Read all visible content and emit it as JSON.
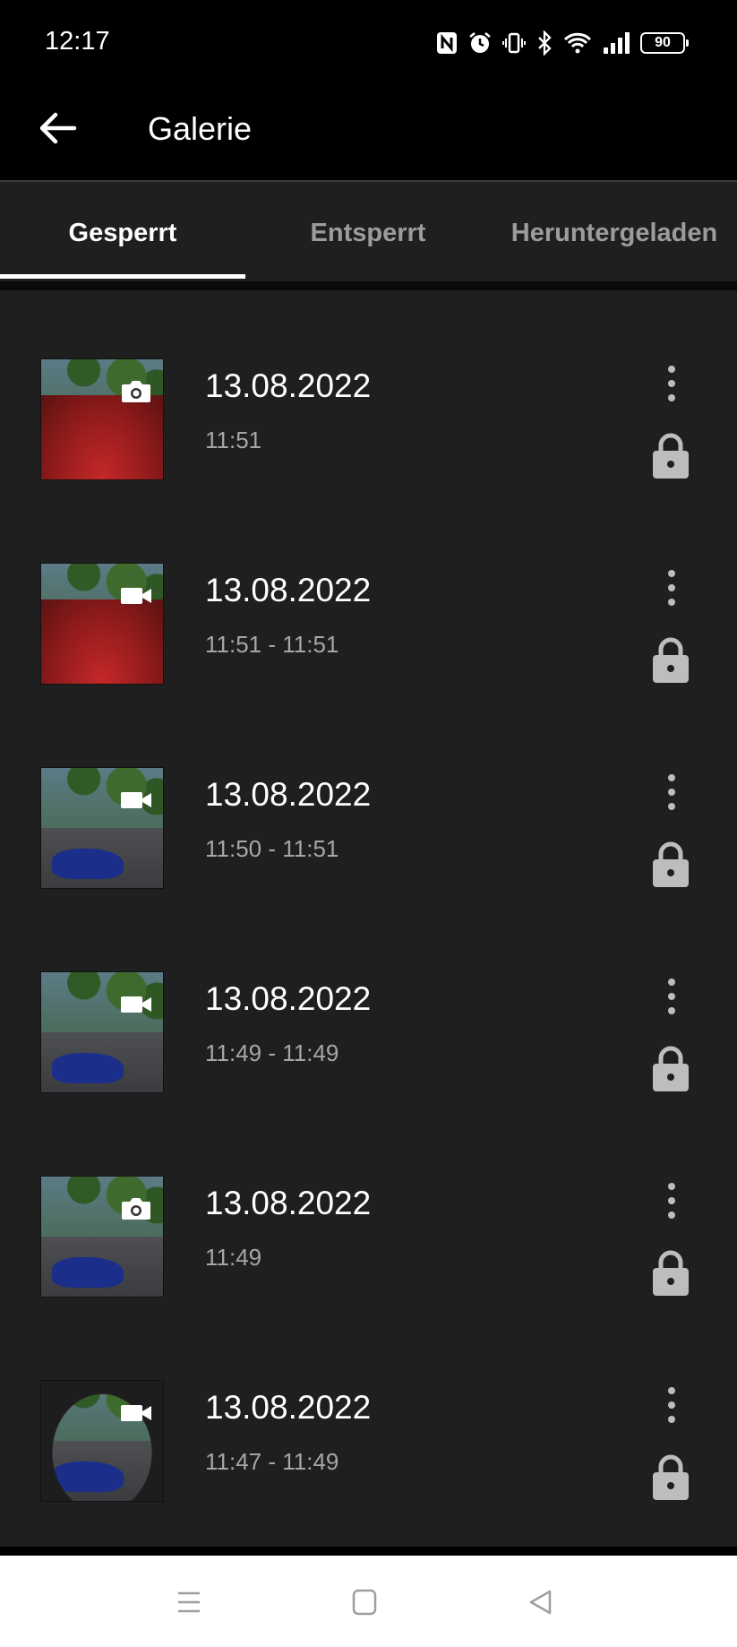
{
  "status_bar": {
    "time": "12:17",
    "battery": "90",
    "icons": [
      "nfc-icon",
      "alarm-icon",
      "vibrate-icon",
      "bluetooth-icon",
      "wifi-icon",
      "signal-icon",
      "battery-icon"
    ]
  },
  "app_bar": {
    "title": "Galerie",
    "back_icon": "arrow-left-icon"
  },
  "tabs": [
    {
      "label": "Gesperrt",
      "active": true
    },
    {
      "label": "Entsperrt",
      "active": false
    },
    {
      "label": "Heruntergeladen",
      "active": false
    }
  ],
  "items": [
    {
      "date": "13.08.2022",
      "time": "11:51",
      "type": "photo",
      "thumb": "red"
    },
    {
      "date": "13.08.2022",
      "time": "11:51 - 11:51",
      "type": "video",
      "thumb": "red"
    },
    {
      "date": "13.08.2022",
      "time": "11:50 - 11:51",
      "type": "video",
      "thumb": "blue"
    },
    {
      "date": "13.08.2022",
      "time": "11:49 - 11:49",
      "type": "video",
      "thumb": "blue"
    },
    {
      "date": "13.08.2022",
      "time": "11:49",
      "type": "photo",
      "thumb": "blue"
    },
    {
      "date": "13.08.2022",
      "time": "11:47 - 11:49",
      "type": "video",
      "thumb": "tunnel"
    }
  ],
  "colors": {
    "background": "#000000",
    "list_background": "#1f1f1f",
    "secondary_text": "#a6a6a6",
    "inactive_tab": "#9c9c9c",
    "icon_gray": "#bdbdbd"
  }
}
